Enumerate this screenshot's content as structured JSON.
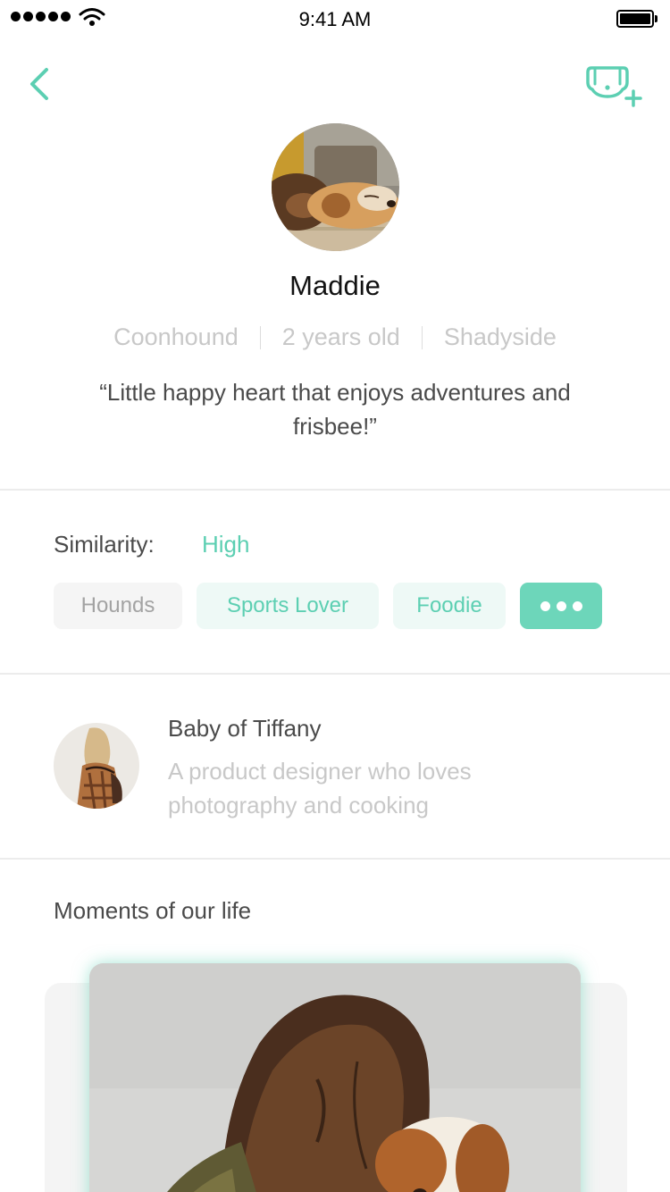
{
  "status_bar": {
    "time": "9:41 AM",
    "signal_bars": 5
  },
  "nav": {
    "back_icon": "chevron-left-icon",
    "add_icon": "dog-add-icon"
  },
  "profile": {
    "name": "Maddie",
    "breed": "Coonhound",
    "age": "2 years old",
    "location": "Shadyside",
    "quote": "“Little happy heart that enjoys adventures and frisbee!”",
    "avatar_icon": "dog-photo"
  },
  "similarity": {
    "label": "Similarity:",
    "value": "High",
    "tags": [
      "Hounds",
      "Sports Lover",
      "Foodie"
    ],
    "more_icon": "more-dots-icon"
  },
  "owner": {
    "title": "Baby of Tiffany",
    "bio": "A product designer who loves photography and cooking"
  },
  "moments": {
    "title": "Moments of our life"
  },
  "colors": {
    "accent": "#5ccfb2",
    "accent_light": "#eef9f6",
    "text_primary": "#4a4a4a",
    "text_muted": "#c8c8c8"
  }
}
